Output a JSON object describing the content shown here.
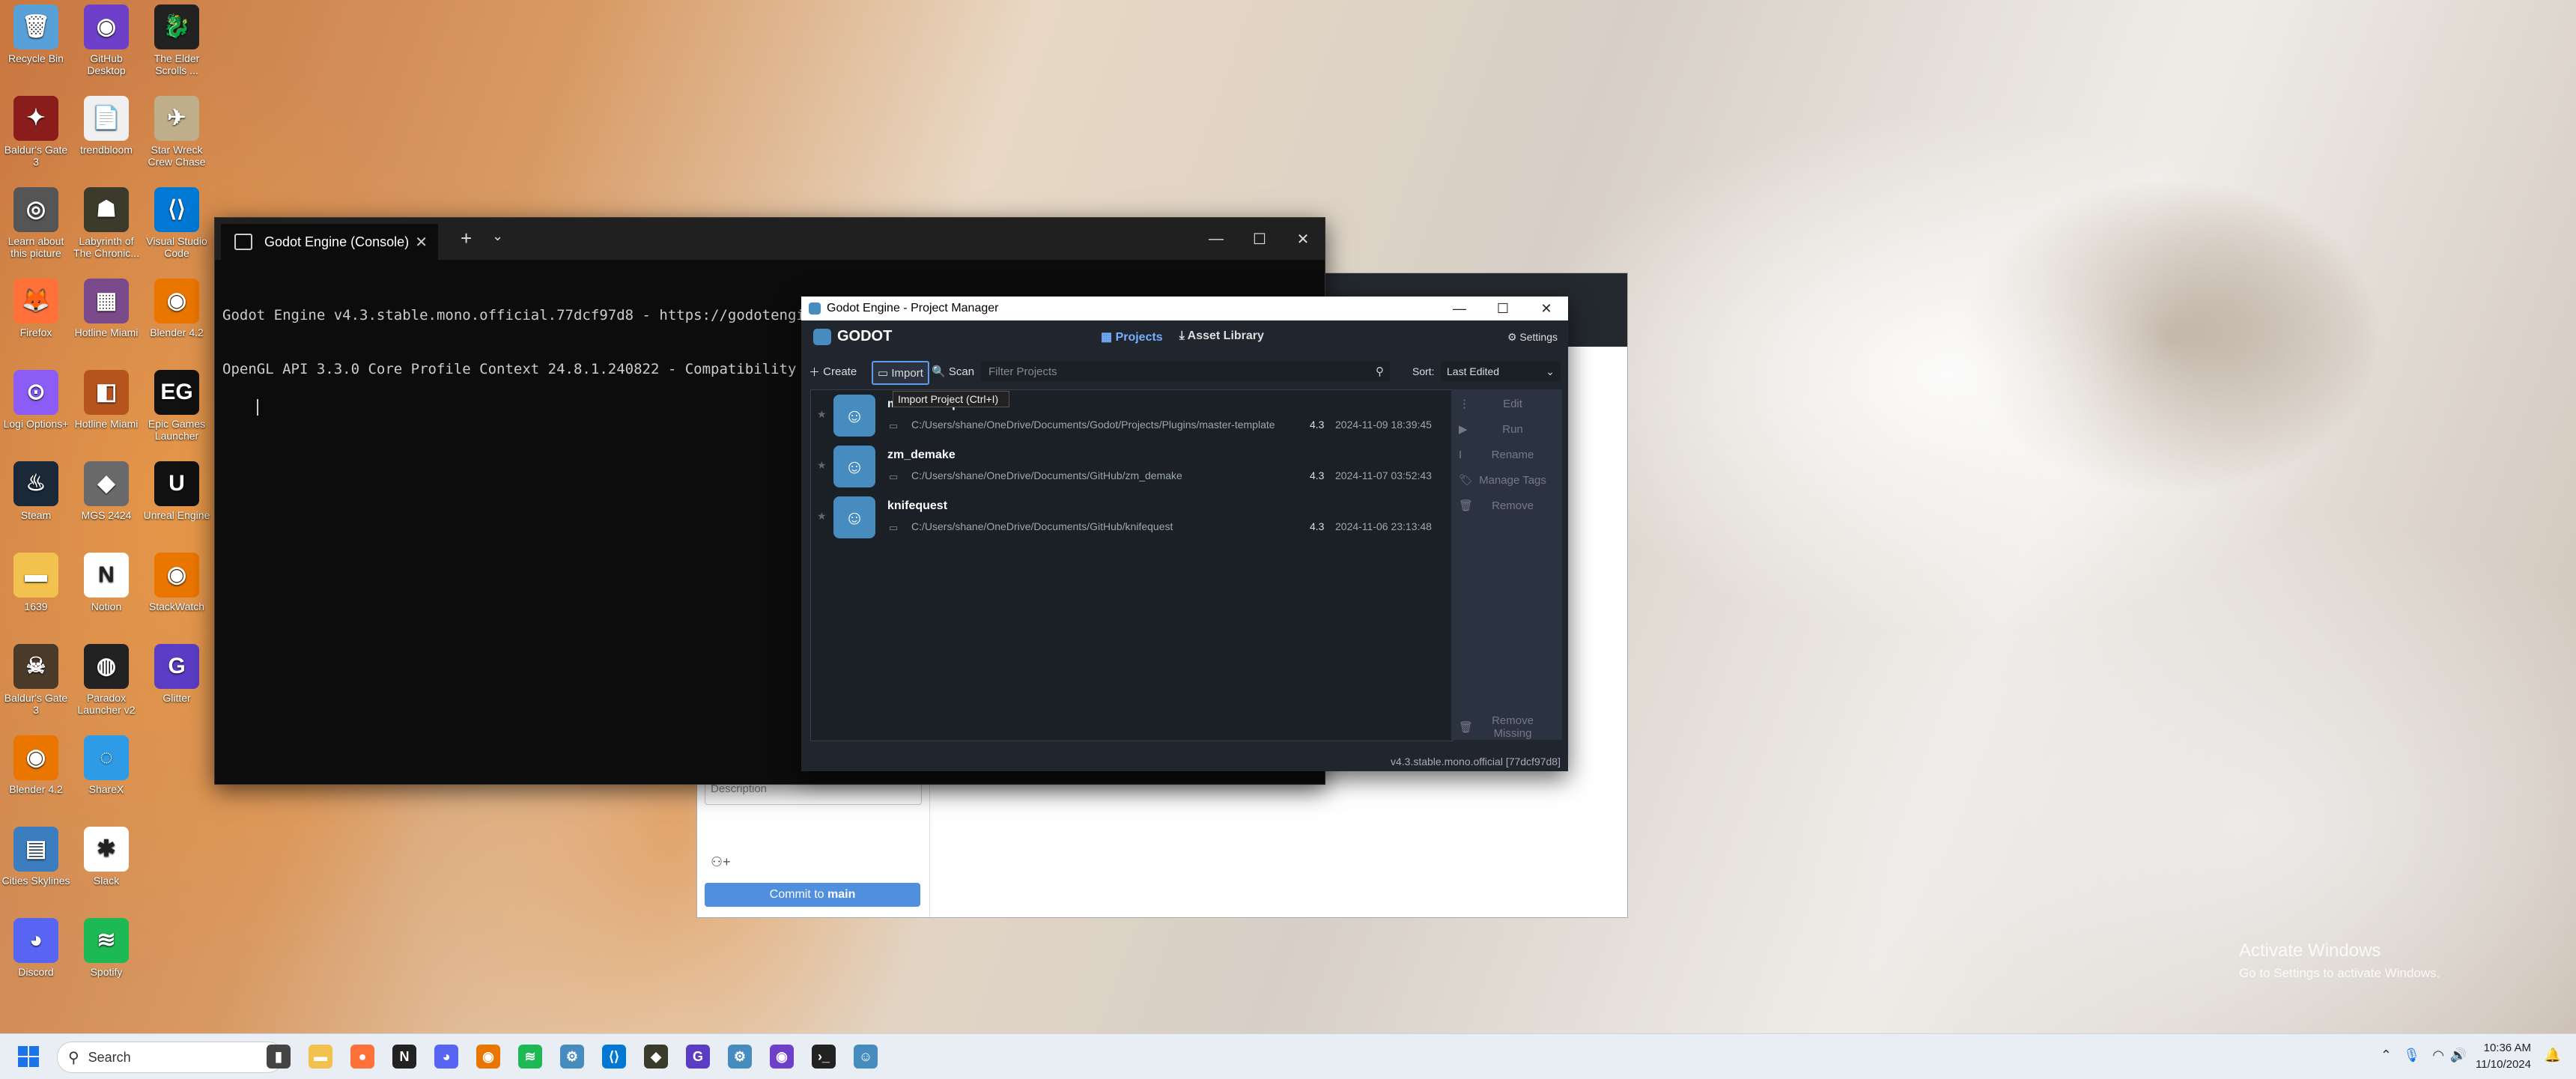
{
  "desktop": {
    "icons": [
      {
        "label": "Recycle Bin",
        "name": "recycle-bin-icon",
        "color": "#5aa0d8",
        "glyph": "🗑"
      },
      {
        "label": "GitHub Desktop",
        "name": "github-desktop-icon",
        "color": "#6e40c9",
        "glyph": "◉"
      },
      {
        "label": "The Elder Scrolls ...",
        "name": "elder-scrolls-icon",
        "color": "#222222",
        "glyph": "🐉"
      },
      {
        "label": "Baldur's Gate 3",
        "name": "game-icon",
        "color": "#8a1c1c",
        "glyph": "✦"
      },
      {
        "label": "trendbloom",
        "name": "document-icon",
        "color": "#f0f0f0",
        "glyph": "📄"
      },
      {
        "label": "Star Wreck Crew Chase",
        "name": "game-icon",
        "color": "#bfae8a",
        "glyph": "✈"
      },
      {
        "label": "Learn about this picture",
        "name": "learn-picture-icon",
        "color": "#555555",
        "glyph": "◎"
      },
      {
        "label": "Labyrinth of The Chronic...",
        "name": "game-icon",
        "color": "#3b3b2b",
        "glyph": "☗"
      },
      {
        "label": "Visual Studio Code",
        "name": "vscode-icon",
        "color": "#0078d4",
        "glyph": "⟨⟩"
      },
      {
        "label": "Firefox",
        "name": "firefox-icon",
        "color": "#ff7139",
        "glyph": "🦊"
      },
      {
        "label": "Hotline Miami",
        "name": "game-icon",
        "color": "#7a4a8a",
        "glyph": "▦"
      },
      {
        "label": "Blender 4.2",
        "name": "blender-icon",
        "color": "#ea7600",
        "glyph": "◉"
      },
      {
        "label": "Logi Options+",
        "name": "logi-icon",
        "color": "#8b5cf6",
        "glyph": "⊙"
      },
      {
        "label": "Hotline Miami",
        "name": "game-icon",
        "color": "#b5541c",
        "glyph": "◧"
      },
      {
        "label": "Epic Games Launcher",
        "name": "epic-games-icon",
        "color": "#111111",
        "glyph": "EG"
      },
      {
        "label": "Steam",
        "name": "steam-icon",
        "color": "#1b2838",
        "glyph": "♨"
      },
      {
        "label": "MGS 2424",
        "name": "game-icon",
        "color": "#6a6a6a",
        "glyph": "◆"
      },
      {
        "label": "Unreal Engine",
        "name": "unreal-engine-icon",
        "color": "#111111",
        "glyph": "U"
      },
      {
        "label": "1639",
        "name": "folder-icon",
        "color": "#f2c14e",
        "glyph": "▬"
      },
      {
        "label": "Notion",
        "name": "notion-icon",
        "color": "#ffffff",
        "glyph": "N"
      },
      {
        "label": "StackWatch",
        "name": "app-icon",
        "color": "#ea7600",
        "glyph": "◉"
      },
      {
        "label": "Baldur's Gate 3",
        "name": "game-icon",
        "color": "#4a3a2a",
        "glyph": "☠"
      },
      {
        "label": "Paradox Launcher v2",
        "name": "paradox-icon",
        "color": "#222222",
        "glyph": "◍"
      },
      {
        "label": "Glitter",
        "name": "app-icon",
        "color": "#5b3cc4",
        "glyph": "G"
      },
      {
        "label": "Blender 4.2",
        "name": "blender-icon",
        "color": "#ea7600",
        "glyph": "◉"
      },
      {
        "label": "ShareX",
        "name": "sharex-icon",
        "color": "#2e9be6",
        "glyph": "◌"
      },
      {
        "label": "",
        "name": "spacer",
        "color": "transparent",
        "glyph": ""
      },
      {
        "label": "Cities Skylines",
        "name": "game-icon",
        "color": "#3b7dbf",
        "glyph": "▤"
      },
      {
        "label": "Slack",
        "name": "slack-icon",
        "color": "#ffffff",
        "glyph": "✱"
      },
      {
        "label": "",
        "name": "spacer",
        "color": "transparent",
        "glyph": ""
      },
      {
        "label": "Discord",
        "name": "discord-icon",
        "color": "#5865f2",
        "glyph": "◕"
      },
      {
        "label": "Spotify",
        "name": "spotify-icon",
        "color": "#1db954",
        "glyph": "≋"
      }
    ]
  },
  "console": {
    "tab_title": "Godot Engine (Console)",
    "close_glyph": "✕",
    "plus_glyph": "+",
    "chevron_glyph": "⌄",
    "min_glyph": "—",
    "max_glyph": "☐",
    "line1": "Godot Engine v4.3.stable.mono.official.77dcf97d8 - https://godotengine.org",
    "line2": "OpenGL API 3.3.0 Core Profile Context 24.8.1.240822 - Compatibility - Using Device: ATI Technologies Inc. - AMD Radeon T"
  },
  "github": {
    "description_placeholder": "Description",
    "commit_prefix": "Commit to ",
    "commit_branch": "main"
  },
  "godot": {
    "window_title": "Godot Engine - Project Manager",
    "logo_text": "GODOT",
    "tab_projects": "Projects",
    "tab_asset_library": "Asset Library",
    "settings": "Settings",
    "create": "Create",
    "import": "Import",
    "scan": "Scan",
    "filter_placeholder": "Filter Projects",
    "sort_label": "Sort:",
    "sort_value": "Last Edited",
    "tooltip": "Import Project (Ctrl+I)",
    "projects": [
      {
        "name": "master-template",
        "path": "C:/Users/shane/OneDrive/Documents/Godot/Projects/Plugins/master-template",
        "version": "4.3",
        "date": "2024-11-09 18:39:45"
      },
      {
        "name": "zm_demake",
        "path": "C:/Users/shane/OneDrive/Documents/GitHub/zm_demake",
        "version": "4.3",
        "date": "2024-11-07 03:52:43"
      },
      {
        "name": "knifequest",
        "path": "C:/Users/shane/OneDrive/Documents/GitHub/knifequest",
        "version": "4.3",
        "date": "2024-11-06 23:13:48"
      }
    ],
    "side_buttons": [
      "Edit",
      "Run",
      "Rename",
      "Manage Tags",
      "Remove"
    ],
    "remove_missing": "Remove Missing",
    "version_footer": "v4.3.stable.mono.official [77dcf97d8]"
  },
  "watermark": {
    "line1": "Activate Windows",
    "line2": "Go to Settings to activate Windows."
  },
  "taskbar": {
    "search_text": "Search",
    "time": "10:36 AM",
    "date": "11/10/2024"
  }
}
